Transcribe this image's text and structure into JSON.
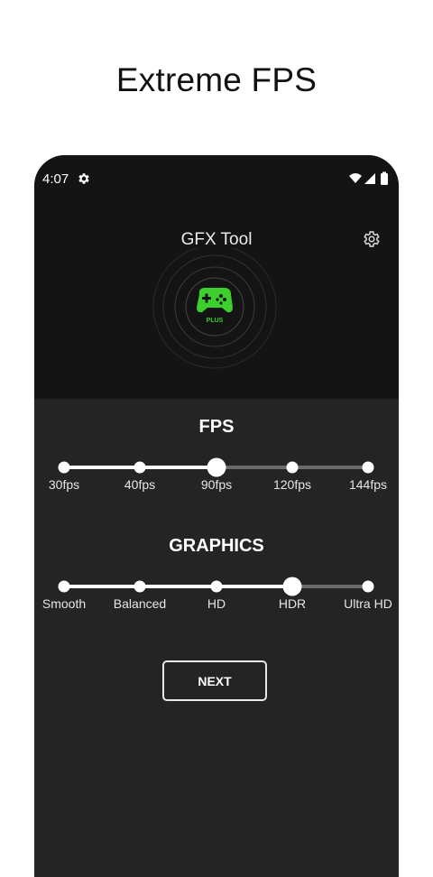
{
  "promo": {
    "title": "Extreme FPS"
  },
  "status_bar": {
    "time": "4:07",
    "icons": [
      "gear-icon",
      "wifi-icon",
      "signal-icon",
      "battery-icon"
    ]
  },
  "app": {
    "title": "GFX Tool",
    "logo_badge": "PLUS",
    "accent_color": "#3ccf2e"
  },
  "fps": {
    "title": "FPS",
    "options": [
      "30fps",
      "40fps",
      "90fps",
      "120fps",
      "144fps"
    ],
    "selected_index": 2
  },
  "graphics": {
    "title": "GRAPHICS",
    "options": [
      "Smooth",
      "Balanced",
      "HD",
      "HDR",
      "Ultra HD"
    ],
    "selected_index": 3
  },
  "next_button": {
    "label": "NEXT"
  }
}
